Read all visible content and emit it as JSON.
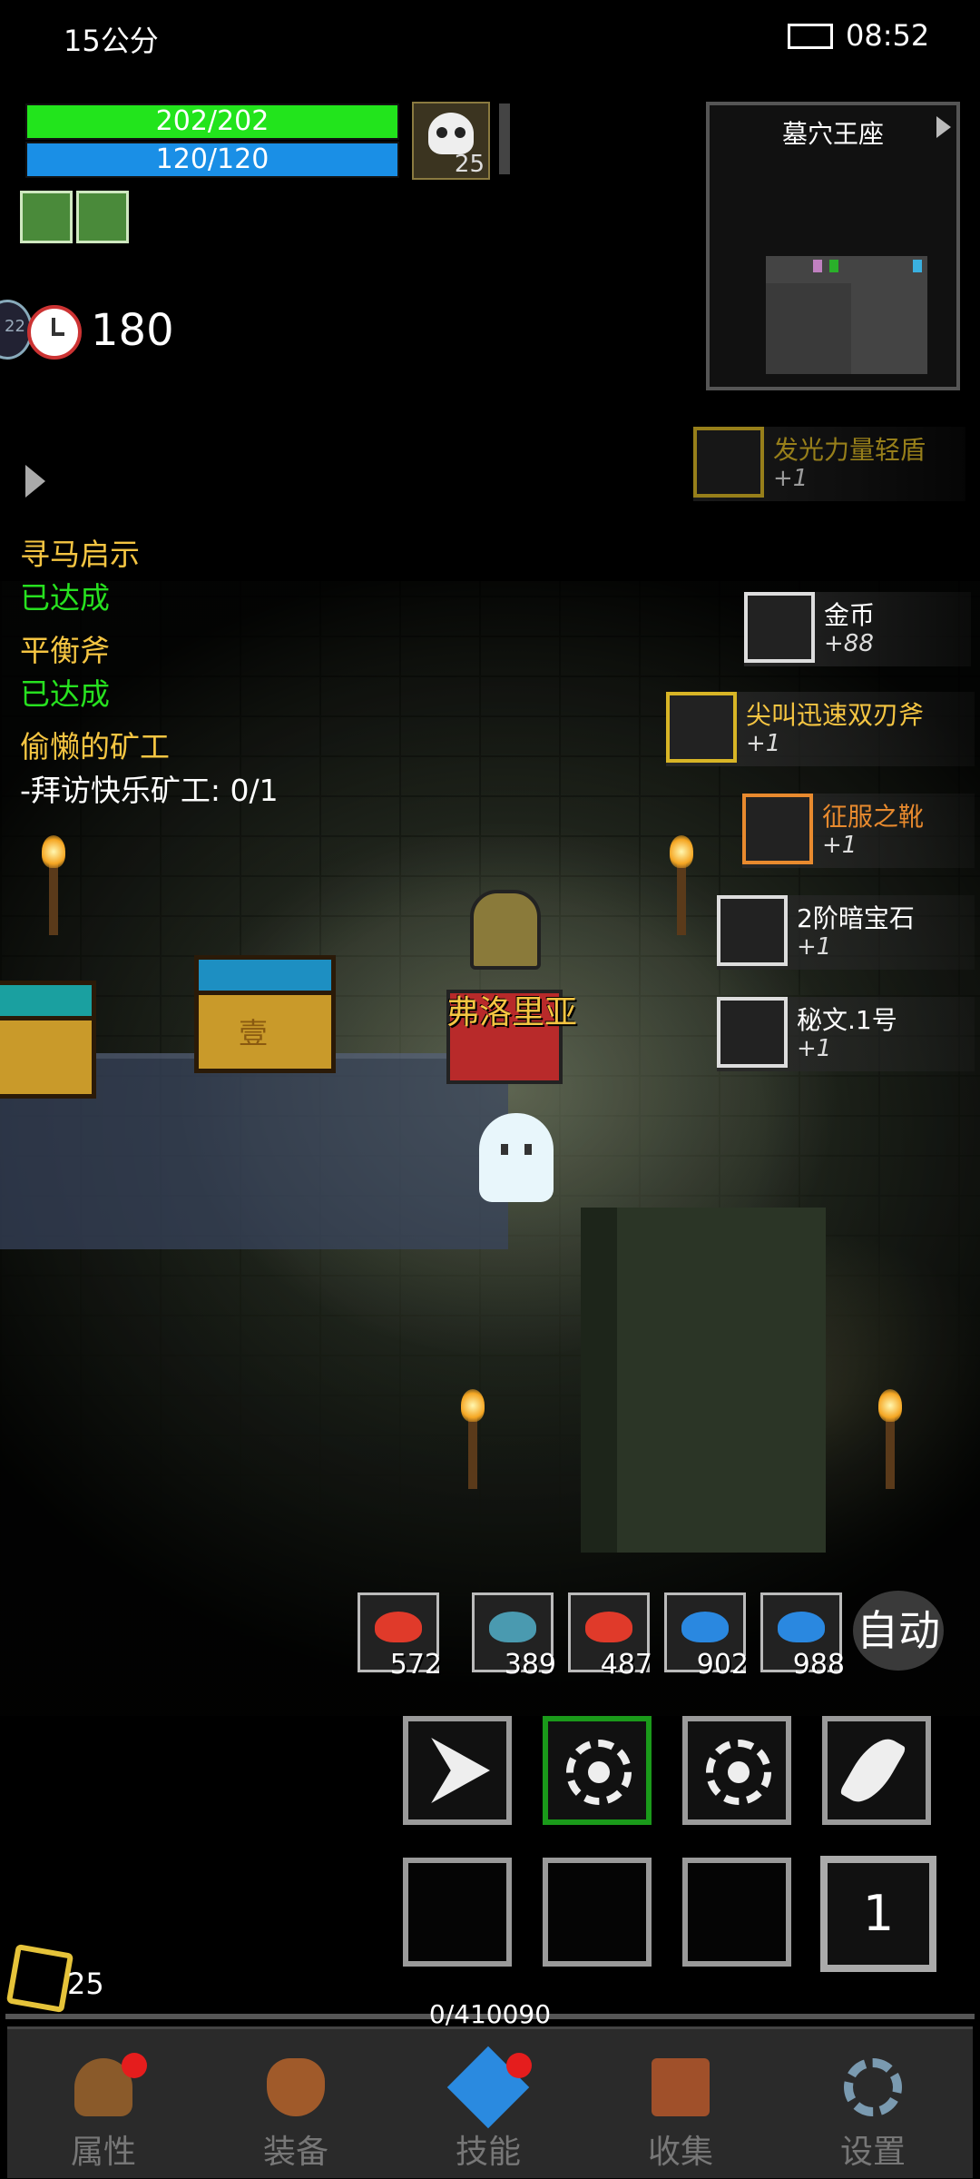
{
  "status_bar": {
    "left_text": "15公分",
    "time": "08:52"
  },
  "player": {
    "hp": "202/202",
    "mp": "120/120",
    "level": "25"
  },
  "timer": {
    "badge": "22",
    "value": "180"
  },
  "minimap": {
    "title": "墓穴王座"
  },
  "quests": [
    {
      "title": "寻马启示",
      "status": "已达成"
    },
    {
      "title": "平衡斧",
      "status": "已达成"
    },
    {
      "title": "偷懒的矿工",
      "step": "-拜访快乐矿工: 0/1"
    }
  ],
  "loot": [
    {
      "name": "发光力量轻盾",
      "count": "+1",
      "color": "#d8b526"
    },
    {
      "name": "金币",
      "count": "+88",
      "color": "#ffffff"
    },
    {
      "name": "尖叫迅速双刃斧",
      "count": "+1",
      "color": "#f5c542"
    },
    {
      "name": "征服之靴",
      "count": "+1",
      "color": "#e88a2e"
    },
    {
      "name": "2阶暗宝石",
      "count": "+1",
      "color": "#ffffff"
    },
    {
      "name": "秘文.1号",
      "count": "+1",
      "color": "#ffffff"
    }
  ],
  "character": {
    "name": "弗洛里亚"
  },
  "chest": {
    "mark": "壹"
  },
  "potions": [
    {
      "count": "572",
      "color": "#e03a2a"
    },
    {
      "count": "389",
      "color": "#4a9ab0"
    },
    {
      "count": "487",
      "color": "#e03a2a"
    },
    {
      "count": "902",
      "color": "#2a88e0"
    },
    {
      "count": "988",
      "color": "#2a88e0"
    }
  ],
  "auto_label": "自动",
  "slot_number": "1",
  "currency": "25",
  "experience": "0/410090",
  "nav": [
    {
      "label": "属性",
      "badge": true
    },
    {
      "label": "装备",
      "badge": false
    },
    {
      "label": "技能",
      "badge": true
    },
    {
      "label": "收集",
      "badge": false
    },
    {
      "label": "设置",
      "badge": false
    }
  ],
  "colors": {
    "hp": "#22e41c",
    "mp": "#1a8fe6",
    "quest_title": "#f5c542",
    "quest_done": "#27e11f"
  }
}
